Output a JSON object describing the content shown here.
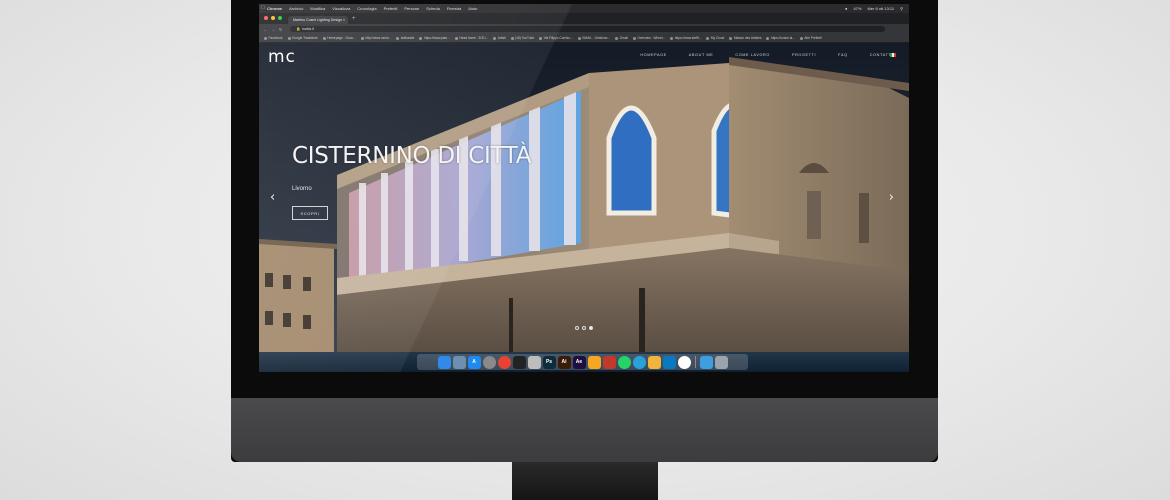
{
  "menubar": {
    "items": [
      "Chrome",
      "Archivio",
      "Modifica",
      "Visualizza",
      "Cronologia",
      "Preferiti",
      "Persone",
      "Scheda",
      "Finestra",
      "Aiuto"
    ],
    "status": "47%",
    "clock": "Mer 6 ott 13:11"
  },
  "browser": {
    "tab_title": "Martino Cosmi Lighting Design",
    "url": "mclds.it",
    "bookmarks": [
      "Facebook",
      "Google Traduttore",
      "Homepage - Docu...",
      "http://www.mosb...",
      "skillcastle",
      "https://www.plan...",
      "Head home - B.B.I...",
      "Artisti",
      "(18) YouTube",
      "Via Filippo Corridu...",
      "GMAIL - Gestione...",
      "Gmail",
      "Overview - Wheel...",
      "https://www.stefff...",
      "My Cloud",
      "Maison des Artistes",
      "https://cosmi.al...",
      "Altri Preferiti"
    ]
  },
  "site": {
    "logo": "mc",
    "nav": [
      "HOMEPAGE",
      "ABOUT ME",
      "COME LAVORO",
      "PROGETTI",
      "F&Q",
      "CONTATTI"
    ],
    "hero_title": "CISTERNINO DI CITTÀ",
    "hero_subtitle": "Livorno",
    "hero_button": "SCOPRI",
    "slides": 3,
    "active_slide": 3
  },
  "dock": {
    "apps": [
      {
        "name": "finder",
        "label": "",
        "color": "#2f8ae8"
      },
      {
        "name": "preview",
        "label": "",
        "color": "#6c8fb2"
      },
      {
        "name": "app-store",
        "label": "A",
        "color": "#1e8bf0"
      },
      {
        "name": "launchpad",
        "label": "",
        "color": "#8a8a8a"
      },
      {
        "name": "chrome",
        "label": "",
        "color": "#e94235"
      },
      {
        "name": "inkscape",
        "label": "",
        "color": "#222222"
      },
      {
        "name": "keyboard",
        "label": "",
        "color": "#bdbdbd"
      },
      {
        "name": "photoshop",
        "label": "Ps",
        "color": "#0f2c3d"
      },
      {
        "name": "illustrator",
        "label": "Ai",
        "color": "#3a1b05"
      },
      {
        "name": "after-effects",
        "label": "Ae",
        "color": "#1f0e40"
      },
      {
        "name": "sketch",
        "label": "",
        "color": "#f5a623"
      },
      {
        "name": "photo-booth",
        "label": "",
        "color": "#c0392b"
      },
      {
        "name": "whatsapp",
        "label": "",
        "color": "#25d366"
      },
      {
        "name": "telegram",
        "label": "",
        "color": "#2aa1da"
      },
      {
        "name": "pages",
        "label": "",
        "color": "#f1b43c"
      },
      {
        "name": "trello",
        "label": "",
        "color": "#0b79bf"
      },
      {
        "name": "slack",
        "label": "",
        "color": "#ffffff"
      },
      {
        "name": "folder",
        "label": "",
        "color": "#3e9fe0"
      },
      {
        "name": "trash",
        "label": "",
        "color": "#9aa4ad"
      }
    ]
  }
}
